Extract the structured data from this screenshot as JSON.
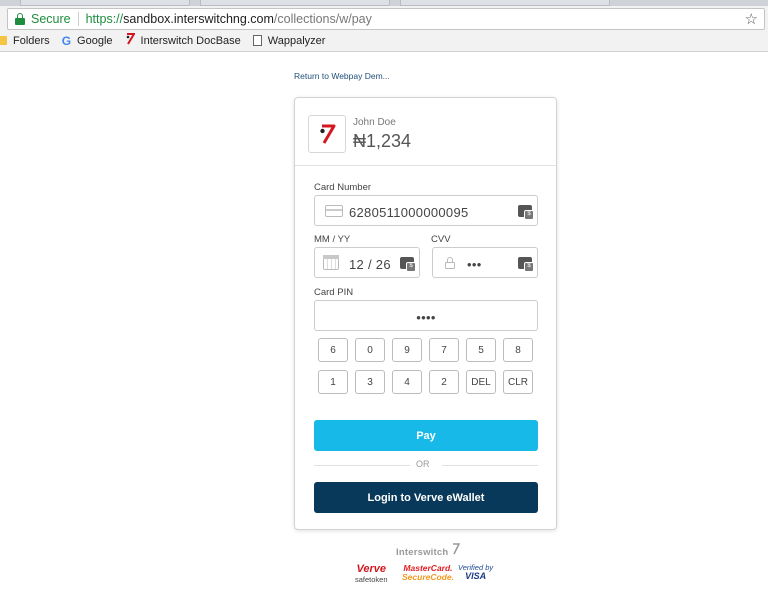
{
  "browser": {
    "secure_label": "Secure",
    "url_scheme": "https://",
    "url_host": "sandbox.interswitchng.com",
    "url_path": "/collections/w/pay",
    "bookmarks": [
      {
        "label": "Folders",
        "icon": "folder-icon"
      },
      {
        "label": "Google",
        "icon": "google-icon"
      },
      {
        "label": "Interswitch DocBase",
        "icon": "interswitch-icon"
      },
      {
        "label": "Wappalyzer",
        "icon": "document-icon"
      }
    ]
  },
  "page": {
    "return_link": "Return to Webpay Dem...",
    "merchant_name": "John Doe",
    "amount": "₦1,234",
    "card_number_label": "Card Number",
    "card_number_value": "6280511000000095",
    "expiry_label": "MM / YY",
    "expiry_value": "12 / 26",
    "cvv_label": "CVV",
    "cvv_value": "•••",
    "pin_label": "Card PIN",
    "pin_value": "••••",
    "keypad_row1": [
      "6",
      "0",
      "9",
      "7",
      "5",
      "8"
    ],
    "keypad_row2": [
      "1",
      "3",
      "4",
      "2",
      "DEL",
      "CLR"
    ],
    "pay_label": "Pay",
    "or_label": "OR",
    "verve_button_label": "Login to Verve eWallet"
  },
  "footer": {
    "brand": "Interswitch",
    "verve_top": "Verve",
    "verve_bottom": "safetoken",
    "mastercard_top": "MasterCard.",
    "mastercard_bottom": "SecureCode.",
    "visa_top": "Verified by",
    "visa_bottom": "VISA"
  },
  "colors": {
    "pay_button": "#16b9e7",
    "verve_button": "#08385a",
    "brand_red": "#d3161f"
  }
}
